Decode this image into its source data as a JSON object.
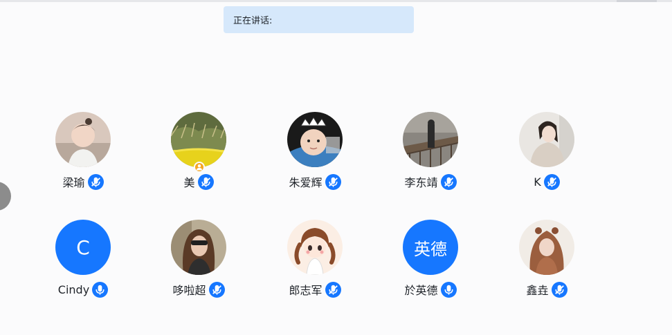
{
  "speaking": {
    "label": "正在讲话:"
  },
  "colors": {
    "accent": "#1677ff",
    "speaking_bar_bg": "#d6e8fb",
    "host_badge": "#f5a623"
  },
  "participants": [
    {
      "name": "梁瑜",
      "avatar": "photo",
      "mic": "muted"
    },
    {
      "name": "美",
      "avatar": "photo",
      "mic": "muted",
      "host": true
    },
    {
      "name": "朱爱辉",
      "avatar": "photo",
      "mic": "muted"
    },
    {
      "name": "李东靖",
      "avatar": "photo",
      "mic": "muted"
    },
    {
      "name": "K",
      "avatar": "photo",
      "mic": "muted"
    },
    {
      "name": "Cindy",
      "avatar": "initial",
      "initial": "C",
      "mic": "on"
    },
    {
      "name": "哆啦超",
      "avatar": "photo",
      "mic": "muted"
    },
    {
      "name": "郎志军",
      "avatar": "photo",
      "mic": "muted"
    },
    {
      "name": "於英德",
      "avatar": "initial",
      "initial": "英德",
      "mic": "on"
    },
    {
      "name": "鑫垚",
      "avatar": "photo",
      "mic": "muted"
    }
  ]
}
